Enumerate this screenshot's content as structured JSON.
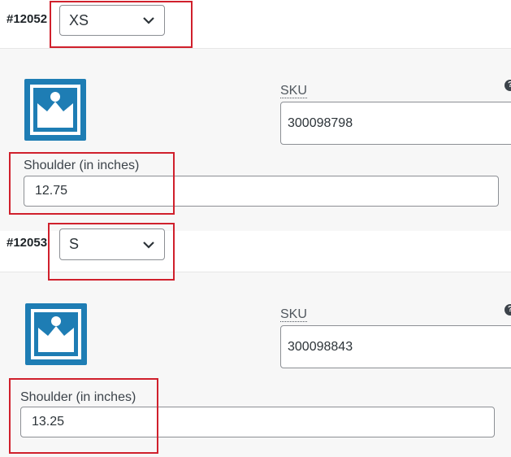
{
  "variations": [
    {
      "id": "#12052",
      "size_value": "XS",
      "sku_label": "SKU",
      "sku_value": "300098798",
      "shoulder_label": "Shoulder (in inches)",
      "shoulder_value": "12.75"
    },
    {
      "id": "#12053",
      "size_value": "S",
      "sku_label": "SKU",
      "sku_value": "300098843",
      "shoulder_label": "Shoulder (in inches)",
      "shoulder_value": "13.25"
    }
  ],
  "icons": {
    "dropdown": "chevron-down-icon",
    "thumbnail": "image-placeholder-icon",
    "help": "help-icon"
  },
  "colors": {
    "highlight": "#d0202c",
    "thumbnail_bg": "#1e7db4"
  }
}
